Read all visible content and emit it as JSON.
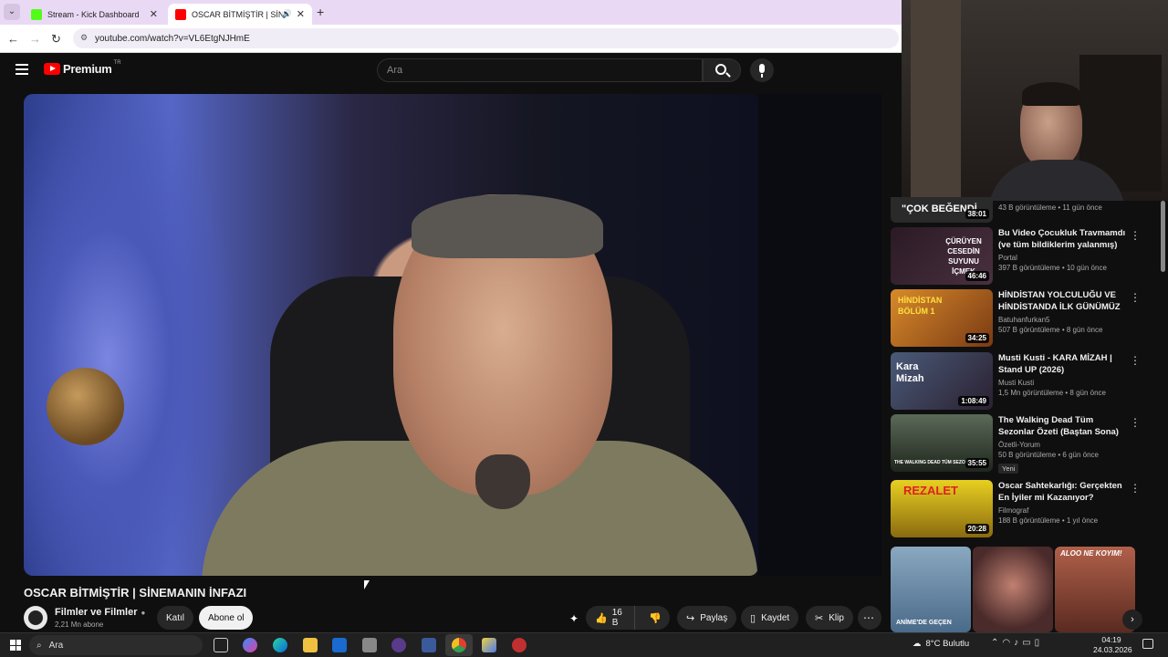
{
  "browser": {
    "tabs": [
      {
        "title": "Stream - Kick Dashboard"
      },
      {
        "title": "OSCAR BİTMİŞTİR | SİNEMA"
      }
    ],
    "url": "youtube.com/watch?v=VL6EtgNJHmE"
  },
  "yt": {
    "logo": "Premium",
    "region": "TR",
    "search_placeholder": "Ara"
  },
  "video": {
    "title": "OSCAR BİTMİŞTİR | SİNEMANIN İNFAZI",
    "channel": "Filmler ve Filmler",
    "subs": "2,21 Mn abone",
    "join": "Katıl",
    "subscribe": "Abone ol",
    "likes": "16 B",
    "share": "Paylaş",
    "save": "Kaydet",
    "clip": "Klip"
  },
  "sidebar": {
    "partial_meta": "43 B görüntüleme • 11 gün önce",
    "partial_duration": "38:01",
    "partial_thumb_text": "\"ÇOK BEĞENDİ",
    "items": [
      {
        "title": "Bu Video Çocukluk Travmamdı (ve tüm bildiklerim yalanmış)",
        "channel": "Portal",
        "meta": "397 B görüntüleme • 10 gün önce",
        "duration": "46:46",
        "thumb_text": "ÇÜRÜYEN CESEDİN SUYUNU İÇMEK",
        "color": "#3a2a30"
      },
      {
        "title": "HİNDİSTAN YOLCULUĞU VE HİNDİSTANDA İLK GÜNÜMÜZ",
        "channel": "Batuhanfurkan5",
        "meta": "507 B görüntüleme • 8 gün önce",
        "duration": "34:25",
        "thumb_text": "HİNDİSTAN BÖLÜM 1",
        "color": "#b86a1c"
      },
      {
        "title": "Musti Kusti - KARA MİZAH | Stand UP (2026)",
        "channel": "Musti Kusti",
        "meta": "1,5 Mn görüntüleme • 8 gün önce",
        "duration": "1:08:49",
        "thumb_text": "Kara Mizah",
        "color": "#3a4660"
      },
      {
        "title": "The Walking Dead Tüm Sezonlar Özeti (Baştan Sona)",
        "channel": "Özetli-Yorum",
        "meta": "50 B görüntüleme • 6 gün önce",
        "duration": "35:55",
        "thumb_text": "THE WALKING DEAD TÜM SEZON",
        "color": "#39453a",
        "badge": "Yeni"
      },
      {
        "title": "Oscar Sahtekarlığı: Gerçekten En İyiler mi Kazanıyor?",
        "channel": "Filmograf",
        "meta": "188 B görüntüleme • 1 yıl önce",
        "duration": "20:28",
        "thumb_text": "REZALET",
        "color": "#a08a10"
      }
    ],
    "shorts": [
      {
        "text": "ANİME'DE GEÇEN",
        "color": "#5a7ea0"
      },
      {
        "text": "",
        "color": "#4a2a2a"
      },
      {
        "text": "ALOO NE KOYIM!",
        "color": "#7a3a30"
      }
    ]
  },
  "taskbar": {
    "search": "Ara",
    "weather": "8°C  Bulutlu",
    "time": "04:19",
    "date": "24.03.2026"
  }
}
